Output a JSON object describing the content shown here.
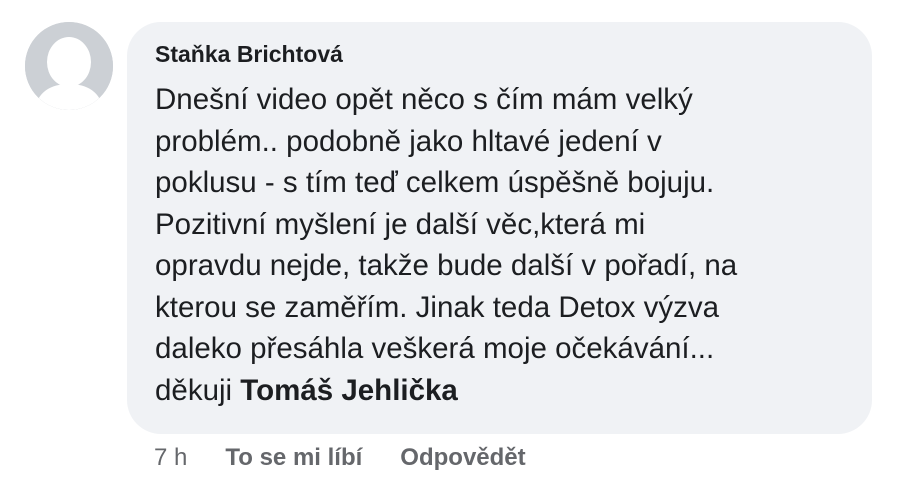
{
  "comment": {
    "avatar_icon": "default-profile-silhouette-icon",
    "author": "Staňka Brichtová",
    "body_lines": [
      "Dnešní video opět něco s čím mám velký",
      "problém.. podobně jako hltavé jedení v",
      "poklusu - s tím teď celkem úspěšně bojuju.",
      "Pozitivní myšlení je další věc,která mi",
      "opravdu nejde, takže bude další v pořadí, na",
      "kterou se zaměřím. Jinak teda Detox výzva",
      "daleko přesáhla veškerá moje očekávání..."
    ],
    "last_line_prefix": "děkuji ",
    "mention": "Tomáš Jehlička"
  },
  "actions": {
    "timestamp": "7 h",
    "like_label": "To se mi líbí",
    "reply_label": "Odpovědět"
  },
  "colors": {
    "bubble_background": "#f0f2f5",
    "text": "#1c1e21",
    "meta_text": "#65676b",
    "avatar_background": "#ccd0d5"
  }
}
